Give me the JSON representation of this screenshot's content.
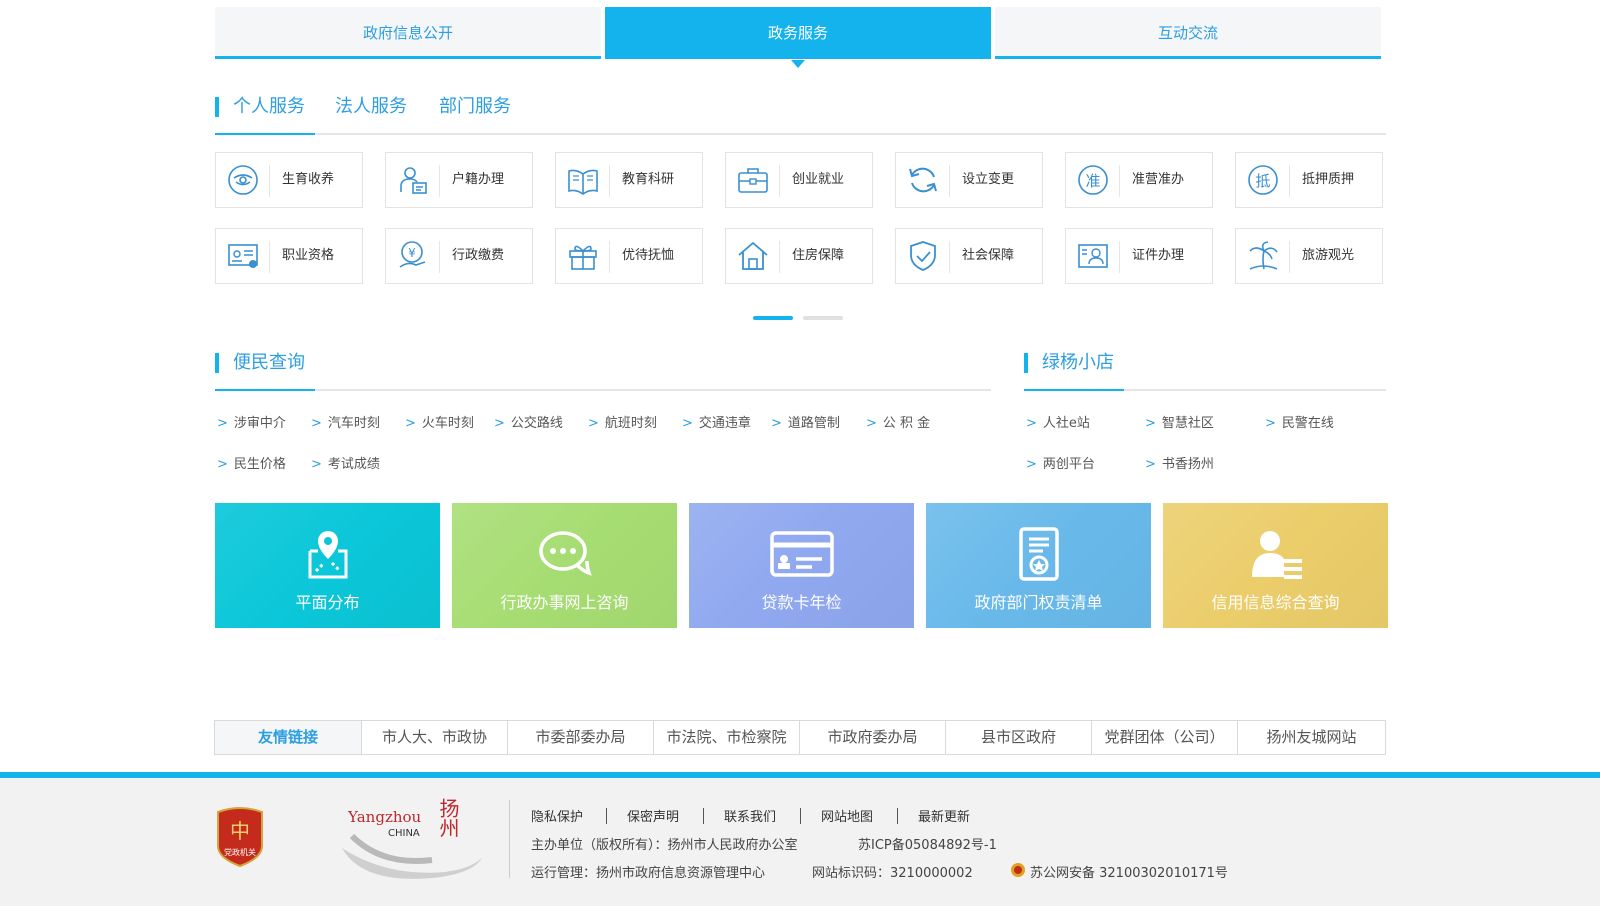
{
  "tabs": [
    {
      "label": "政府信息公开"
    },
    {
      "label": "政务服务"
    },
    {
      "label": "互动交流"
    }
  ],
  "service_tabs": [
    {
      "label": "个人服务"
    },
    {
      "label": "法人服务"
    },
    {
      "label": "部门服务"
    }
  ],
  "services_row1": [
    {
      "label": "生育收养",
      "icon": "baby-icon"
    },
    {
      "label": "户籍办理",
      "icon": "household-register-icon"
    },
    {
      "label": "教育科研",
      "icon": "book-icon"
    },
    {
      "label": "创业就业",
      "icon": "briefcase-icon"
    },
    {
      "label": "设立变更",
      "icon": "refresh-icon"
    },
    {
      "label": "准营准办",
      "icon": "zhun-badge-icon"
    },
    {
      "label": "抵押质押",
      "icon": "di-badge-icon"
    }
  ],
  "services_row2": [
    {
      "label": "职业资格",
      "icon": "certificate-icon"
    },
    {
      "label": "行政缴费",
      "icon": "yuan-payment-icon"
    },
    {
      "label": "优待抚恤",
      "icon": "gift-icon"
    },
    {
      "label": "住房保障",
      "icon": "house-icon"
    },
    {
      "label": "社会保障",
      "icon": "shield-check-icon"
    },
    {
      "label": "证件办理",
      "icon": "id-card-icon"
    },
    {
      "label": "旅游观光",
      "icon": "palm-tree-icon"
    }
  ],
  "convenience": {
    "title": "便民查询",
    "links_row1": [
      "涉审中介",
      "汽车时刻",
      "火车时刻",
      "公交路线",
      "航班时刻",
      "交通违章",
      "道路管制",
      "公 积 金"
    ],
    "links_row2": [
      "民生价格",
      "考试成绩"
    ]
  },
  "shop": {
    "title": "绿杨小店",
    "links_row1": [
      "人社e站",
      "智慧社区",
      "民警在线"
    ],
    "links_row2": [
      "两创平台",
      "书香扬州"
    ]
  },
  "link_arrow": ">",
  "banners": [
    {
      "label": "平面分布",
      "color": "#0bc7d9",
      "icon": "map-pin-icon"
    },
    {
      "label": "行政办事网上咨询",
      "color": "#a6dd72",
      "icon": "chat-bubble-icon"
    },
    {
      "label": "贷款卡年检",
      "color": "#8fa8ef",
      "icon": "bank-card-icon"
    },
    {
      "label": "政府部门权责清单",
      "color": "#68b9ea",
      "icon": "document-badge-icon"
    },
    {
      "label": "信用信息综合查询",
      "color": "#ebcd6a",
      "icon": "user-list-icon"
    }
  ],
  "friend_links": {
    "title": "友情链接",
    "items": [
      "市人大、市政协",
      "市委部委办局",
      "市法院、市检察院",
      "市政府委办局",
      "县市区政府",
      "党群团体（公司）",
      "扬州友城网站"
    ]
  },
  "footer": {
    "badge_text": "党政机关",
    "logo_text": "Yangzhou",
    "logo_sub": "CHINA",
    "logo_seal": "扬州",
    "nav": [
      "隐私保护",
      "保密声明",
      "联系我们",
      "网站地图",
      "最新更新"
    ],
    "sponsor": "主办单位（版权所有）：扬州市人民政府办公室",
    "icp": "苏ICP备05084892号-1",
    "operator": "运行管理：扬州市政府信息资源管理中心",
    "site_code": "网站标识码：3210000002",
    "police": "苏公网安备 32100302010171号"
  },
  "colors": {
    "accent": "#14b3ee",
    "link": "#2d9ee0"
  }
}
